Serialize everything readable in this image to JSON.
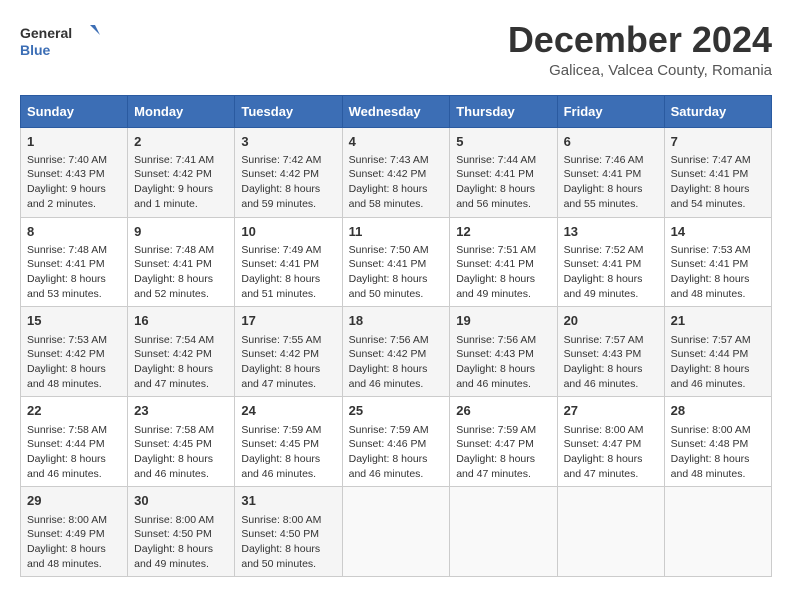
{
  "header": {
    "logo_line1": "General",
    "logo_line2": "Blue",
    "month_title": "December 2024",
    "location": "Galicea, Valcea County, Romania"
  },
  "weekdays": [
    "Sunday",
    "Monday",
    "Tuesday",
    "Wednesday",
    "Thursday",
    "Friday",
    "Saturday"
  ],
  "weeks": [
    [
      {
        "day": "1",
        "content": "Sunrise: 7:40 AM\nSunset: 4:43 PM\nDaylight: 9 hours\nand 2 minutes."
      },
      {
        "day": "2",
        "content": "Sunrise: 7:41 AM\nSunset: 4:42 PM\nDaylight: 9 hours\nand 1 minute."
      },
      {
        "day": "3",
        "content": "Sunrise: 7:42 AM\nSunset: 4:42 PM\nDaylight: 8 hours\nand 59 minutes."
      },
      {
        "day": "4",
        "content": "Sunrise: 7:43 AM\nSunset: 4:42 PM\nDaylight: 8 hours\nand 58 minutes."
      },
      {
        "day": "5",
        "content": "Sunrise: 7:44 AM\nSunset: 4:41 PM\nDaylight: 8 hours\nand 56 minutes."
      },
      {
        "day": "6",
        "content": "Sunrise: 7:46 AM\nSunset: 4:41 PM\nDaylight: 8 hours\nand 55 minutes."
      },
      {
        "day": "7",
        "content": "Sunrise: 7:47 AM\nSunset: 4:41 PM\nDaylight: 8 hours\nand 54 minutes."
      }
    ],
    [
      {
        "day": "8",
        "content": "Sunrise: 7:48 AM\nSunset: 4:41 PM\nDaylight: 8 hours\nand 53 minutes."
      },
      {
        "day": "9",
        "content": "Sunrise: 7:48 AM\nSunset: 4:41 PM\nDaylight: 8 hours\nand 52 minutes."
      },
      {
        "day": "10",
        "content": "Sunrise: 7:49 AM\nSunset: 4:41 PM\nDaylight: 8 hours\nand 51 minutes."
      },
      {
        "day": "11",
        "content": "Sunrise: 7:50 AM\nSunset: 4:41 PM\nDaylight: 8 hours\nand 50 minutes."
      },
      {
        "day": "12",
        "content": "Sunrise: 7:51 AM\nSunset: 4:41 PM\nDaylight: 8 hours\nand 49 minutes."
      },
      {
        "day": "13",
        "content": "Sunrise: 7:52 AM\nSunset: 4:41 PM\nDaylight: 8 hours\nand 49 minutes."
      },
      {
        "day": "14",
        "content": "Sunrise: 7:53 AM\nSunset: 4:41 PM\nDaylight: 8 hours\nand 48 minutes."
      }
    ],
    [
      {
        "day": "15",
        "content": "Sunrise: 7:53 AM\nSunset: 4:42 PM\nDaylight: 8 hours\nand 48 minutes."
      },
      {
        "day": "16",
        "content": "Sunrise: 7:54 AM\nSunset: 4:42 PM\nDaylight: 8 hours\nand 47 minutes."
      },
      {
        "day": "17",
        "content": "Sunrise: 7:55 AM\nSunset: 4:42 PM\nDaylight: 8 hours\nand 47 minutes."
      },
      {
        "day": "18",
        "content": "Sunrise: 7:56 AM\nSunset: 4:42 PM\nDaylight: 8 hours\nand 46 minutes."
      },
      {
        "day": "19",
        "content": "Sunrise: 7:56 AM\nSunset: 4:43 PM\nDaylight: 8 hours\nand 46 minutes."
      },
      {
        "day": "20",
        "content": "Sunrise: 7:57 AM\nSunset: 4:43 PM\nDaylight: 8 hours\nand 46 minutes."
      },
      {
        "day": "21",
        "content": "Sunrise: 7:57 AM\nSunset: 4:44 PM\nDaylight: 8 hours\nand 46 minutes."
      }
    ],
    [
      {
        "day": "22",
        "content": "Sunrise: 7:58 AM\nSunset: 4:44 PM\nDaylight: 8 hours\nand 46 minutes."
      },
      {
        "day": "23",
        "content": "Sunrise: 7:58 AM\nSunset: 4:45 PM\nDaylight: 8 hours\nand 46 minutes."
      },
      {
        "day": "24",
        "content": "Sunrise: 7:59 AM\nSunset: 4:45 PM\nDaylight: 8 hours\nand 46 minutes."
      },
      {
        "day": "25",
        "content": "Sunrise: 7:59 AM\nSunset: 4:46 PM\nDaylight: 8 hours\nand 46 minutes."
      },
      {
        "day": "26",
        "content": "Sunrise: 7:59 AM\nSunset: 4:47 PM\nDaylight: 8 hours\nand 47 minutes."
      },
      {
        "day": "27",
        "content": "Sunrise: 8:00 AM\nSunset: 4:47 PM\nDaylight: 8 hours\nand 47 minutes."
      },
      {
        "day": "28",
        "content": "Sunrise: 8:00 AM\nSunset: 4:48 PM\nDaylight: 8 hours\nand 48 minutes."
      }
    ],
    [
      {
        "day": "29",
        "content": "Sunrise: 8:00 AM\nSunset: 4:49 PM\nDaylight: 8 hours\nand 48 minutes."
      },
      {
        "day": "30",
        "content": "Sunrise: 8:00 AM\nSunset: 4:50 PM\nDaylight: 8 hours\nand 49 minutes."
      },
      {
        "day": "31",
        "content": "Sunrise: 8:00 AM\nSunset: 4:50 PM\nDaylight: 8 hours\nand 50 minutes."
      },
      {
        "day": "",
        "content": ""
      },
      {
        "day": "",
        "content": ""
      },
      {
        "day": "",
        "content": ""
      },
      {
        "day": "",
        "content": ""
      }
    ]
  ]
}
